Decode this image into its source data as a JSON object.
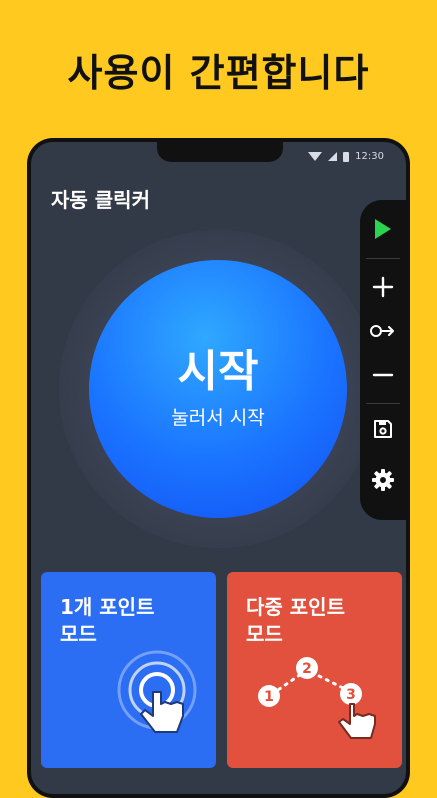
{
  "headline": "사용이 간편합니다",
  "status_bar": {
    "time": "12:30"
  },
  "app": {
    "title": "자동 클릭커",
    "start_button": {
      "title": "시작",
      "subtitle": "눌러서 시작"
    }
  },
  "toolbar": {
    "items": [
      {
        "icon": "play-icon",
        "color": "#2BD44F"
      },
      {
        "icon": "plus-icon"
      },
      {
        "icon": "swipe-icon"
      },
      {
        "icon": "minus-icon"
      },
      {
        "icon": "save-icon"
      },
      {
        "icon": "gear-icon"
      }
    ]
  },
  "modes": {
    "single": {
      "line1": "1개 포인트",
      "line2": "모드",
      "color": "#2B6DF3"
    },
    "multi": {
      "line1": "다중 포인트",
      "line2": "모드",
      "color": "#E2503E",
      "points": [
        "1",
        "2",
        "3"
      ]
    }
  }
}
